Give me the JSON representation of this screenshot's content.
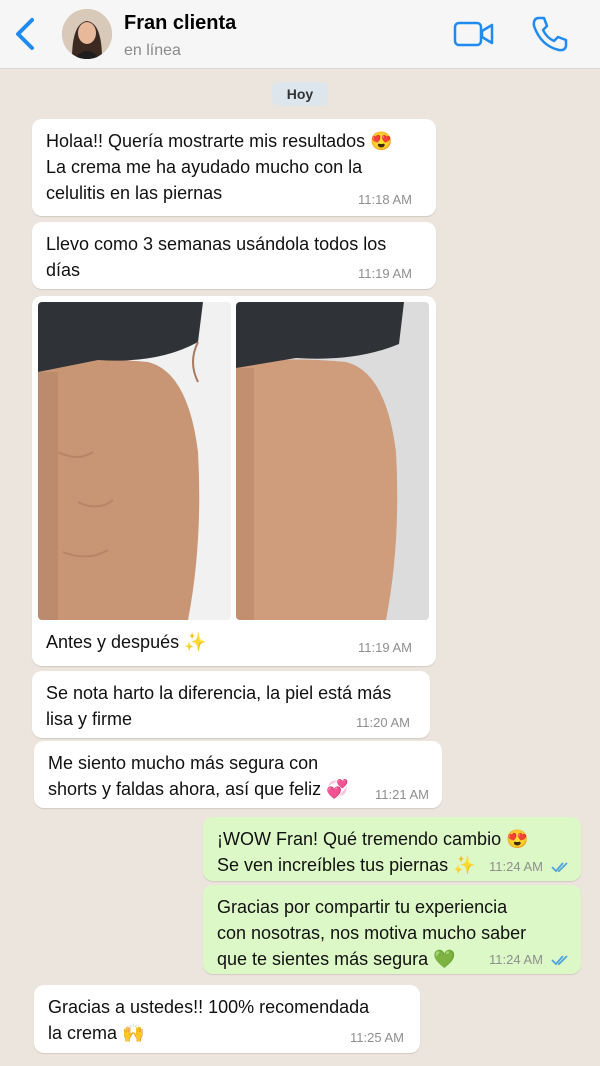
{
  "header": {
    "contact_name": "Fran clienta",
    "status": "en línea"
  },
  "chat": {
    "day_label": "Hoy",
    "messages": [
      {
        "text": "Holaa!! Quería mostrarte mis resultados 😍\nLa crema me ha ayudado mucho con la\ncelulitis en las piernas",
        "time": "11:18 AM"
      },
      {
        "text": "Llevo como 3 semanas usándola todos los\ndías",
        "time": "11:19 AM"
      },
      {
        "caption": "Antes y después ✨",
        "time": "11:19 AM"
      },
      {
        "text": "Se nota harto la diferencia, la piel está más\nlisa y firme",
        "time": "11:20 AM"
      },
      {
        "text": "Me siento mucho más segura con\nshorts y faldas ahora, así que feliz 💞",
        "time": "11:21 AM"
      },
      {
        "text": "¡WOW Fran! Qué tremendo cambio 😍\nSe ven increíbles tus piernas ✨",
        "time": "11:24 AM"
      },
      {
        "text": "Gracias por compartir tu experiencia\ncon nosotras, nos motiva mucho saber\nque te sientes más segura 💚",
        "time": "11:24 AM"
      },
      {
        "text": "Gracias a ustedes!! 100% recomendada\nla crema 🙌",
        "time": "11:25 AM"
      }
    ]
  },
  "colors": {
    "accent": "#1f8bf0",
    "incoming": "#ffffff",
    "outgoing": "#dcf8c6",
    "background": "#ece5dd",
    "read_ticks": "#4fa3e0"
  },
  "icons": [
    "back-chevron-icon",
    "video-call-icon",
    "phone-call-icon",
    "read-ticks-icon"
  ]
}
